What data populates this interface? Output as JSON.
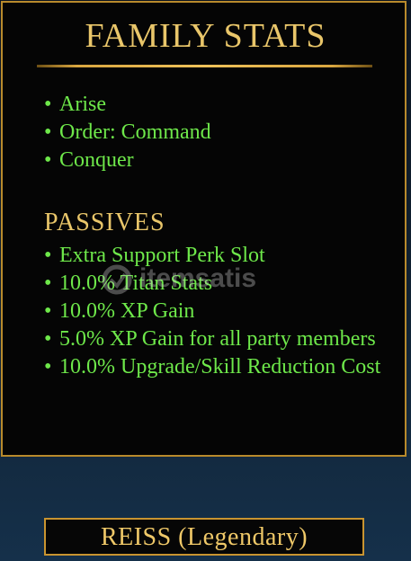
{
  "panel": {
    "title": "FAMILY STATS",
    "family_stats": [
      "Arise",
      "Order: Command",
      "Conquer"
    ],
    "passives_heading": "PASSIVES",
    "passives": [
      "Extra Support Perk Slot",
      "10.0% Titan Stats",
      "10.0% XP Gain",
      "5.0% XP Gain for all party members",
      "10.0% Upgrade/Skill Reduction Cost"
    ],
    "bullet": "•"
  },
  "watermark": {
    "text": "itemsatis"
  },
  "hero": {
    "name": "REISS (Legendary)"
  },
  "colors": {
    "gold": "#e9c66a",
    "green": "#6ee84a",
    "border": "#b88a2c",
    "panel_bg": "#050505"
  }
}
